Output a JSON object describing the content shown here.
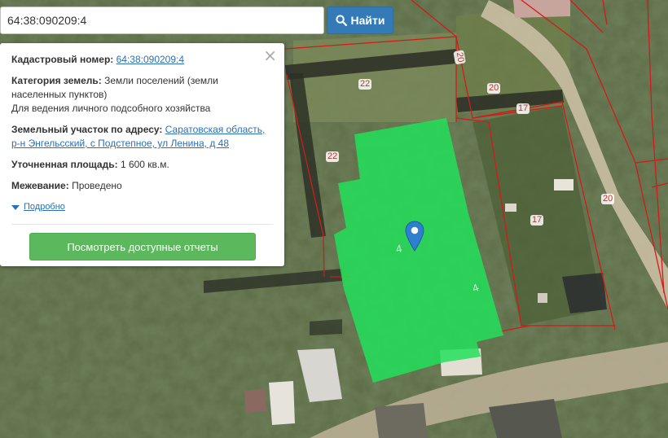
{
  "search": {
    "value": "64:38:090209:4",
    "button_label": "Найти"
  },
  "popup": {
    "close_symbol": "×",
    "cadastral_label": "Кадастровый номер:",
    "cadastral_value": "64:38:090209:4",
    "category_label": "Категория земель:",
    "category_value": "Земли поселений (земли населенных пунктов)",
    "category_usage": "Для ведения личного подсобного хозяйства",
    "address_label": "Земельный участок по адресу:",
    "address_value": "Саратовская область, р-н Энгельсский, с Подстепное, ул Ленина, д 48",
    "area_label": "Уточненная площадь:",
    "area_value": "1 600 кв.м.",
    "survey_label": "Межевание:",
    "survey_value": "Проведено",
    "details_label": "Подробно",
    "reports_button": "Посмотреть доступные отчеты"
  },
  "map": {
    "plot_labels": [
      "20",
      "22",
      "20",
      "17",
      "22",
      "20",
      "17"
    ],
    "parcel_numbers": [
      "4",
      "4"
    ],
    "colors": {
      "parcel_fill": "#22e05a",
      "boundary": "#d41a1a",
      "marker": "#2f7fd0"
    }
  }
}
